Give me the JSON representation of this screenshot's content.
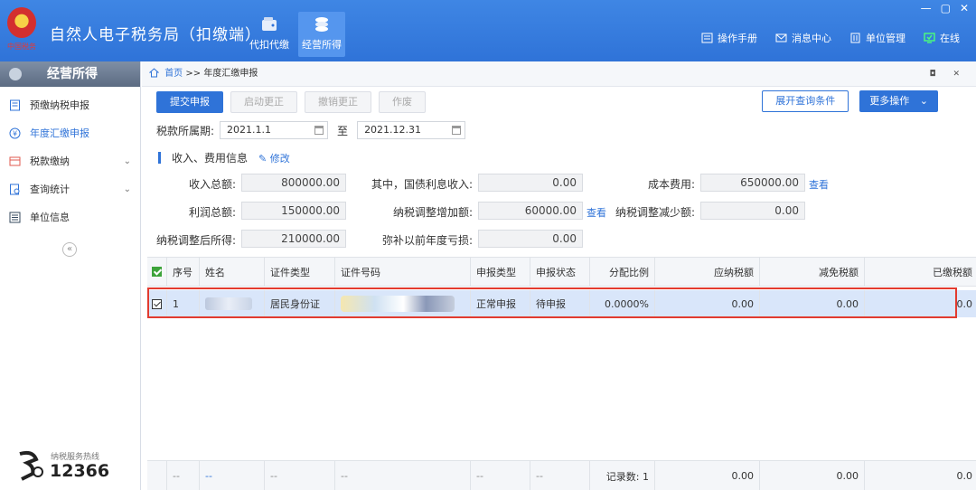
{
  "app": {
    "title": "自然人电子税务局（扣缴端）",
    "logo_text": "中国税务",
    "nav": [
      {
        "label": "代扣代缴",
        "active": false
      },
      {
        "label": "经营所得",
        "active": true
      }
    ],
    "right_menu": {
      "manual": "操作手册",
      "messages": "消息中心",
      "unit_mgmt": "单位管理",
      "status": "在线"
    },
    "window": {
      "minimize": "—",
      "restore": "▢",
      "close": "✕"
    },
    "colors": {
      "primary": "#2f73d8",
      "highlight_outline": "#e23b2f",
      "selected_row": "#d9e6fa",
      "online": "#4cff7a"
    }
  },
  "sidebar": {
    "title": "经营所得",
    "items": [
      {
        "label": "预缴纳税申报",
        "icon": "document-icon",
        "expandable": false,
        "active": false
      },
      {
        "label": "年度汇缴申报",
        "icon": "yen-icon",
        "expandable": false,
        "active": true
      },
      {
        "label": "税款缴纳",
        "icon": "payment-icon",
        "expandable": true,
        "active": false
      },
      {
        "label": "查询统计",
        "icon": "query-icon",
        "expandable": true,
        "active": false
      },
      {
        "label": "单位信息",
        "icon": "list-icon",
        "expandable": false,
        "active": false
      }
    ],
    "collapse": "«",
    "hotline_label": "纳税服务热线",
    "hotline_number": "12366"
  },
  "breadcrumb": {
    "home": "首页",
    "separator": ">>",
    "current": "年度汇缴申报",
    "controls": "◘ ✕"
  },
  "toolbar": {
    "submit": "提交申报",
    "start_correction": "启动更正",
    "cancel_correction": "撤销更正",
    "void": "作废",
    "expand_query": "展开查询条件",
    "more_ops": "更多操作",
    "more_chevron": "⌄"
  },
  "period": {
    "label": "税款所属期:",
    "start": "2021.1.1",
    "to": "至",
    "end": "2021.12.31"
  },
  "income_section": {
    "title": "收入、费用信息",
    "edit": "修改",
    "fields": {
      "total_income_label": "收入总额:",
      "total_income": "800000.00",
      "bond_interest_label": "其中，国债利息收入:",
      "bond_interest": "0.00",
      "cost_label": "成本费用:",
      "cost": "650000.00",
      "profit_label": "利润总额:",
      "profit": "150000.00",
      "adj_increase_label": "纳税调整增加额:",
      "adj_increase": "60000.00",
      "adj_decrease_label": "纳税调整减少额:",
      "adj_decrease": "0.00",
      "adjusted_income_label": "纳税调整后所得:",
      "adjusted_income": "210000.00",
      "prior_loss_label": "弥补以前年度亏损:",
      "prior_loss": "0.00",
      "view_link": "查看"
    }
  },
  "table": {
    "columns": [
      "序号",
      "姓名",
      "证件类型",
      "证件号码",
      "申报类型",
      "申报状态",
      "分配比例",
      "应纳税额",
      "减免税额",
      "已缴税额"
    ],
    "rows": [
      {
        "index": "1",
        "name": "",
        "id_type": "居民身份证",
        "id_number": "",
        "decl_type": "正常申报",
        "decl_status": "待申报",
        "ratio": "0.0000%",
        "tax_payable": "0.00",
        "tax_relief": "0.00",
        "tax_paid": "0.0"
      }
    ],
    "footer": {
      "c1": "--",
      "c2": "--",
      "c3": "--",
      "c4": "--",
      "c5": "--",
      "c6": "--",
      "record_count": "记录数: 1",
      "tax_payable": "0.00",
      "tax_relief": "0.00",
      "tax_paid": "0.0"
    }
  }
}
